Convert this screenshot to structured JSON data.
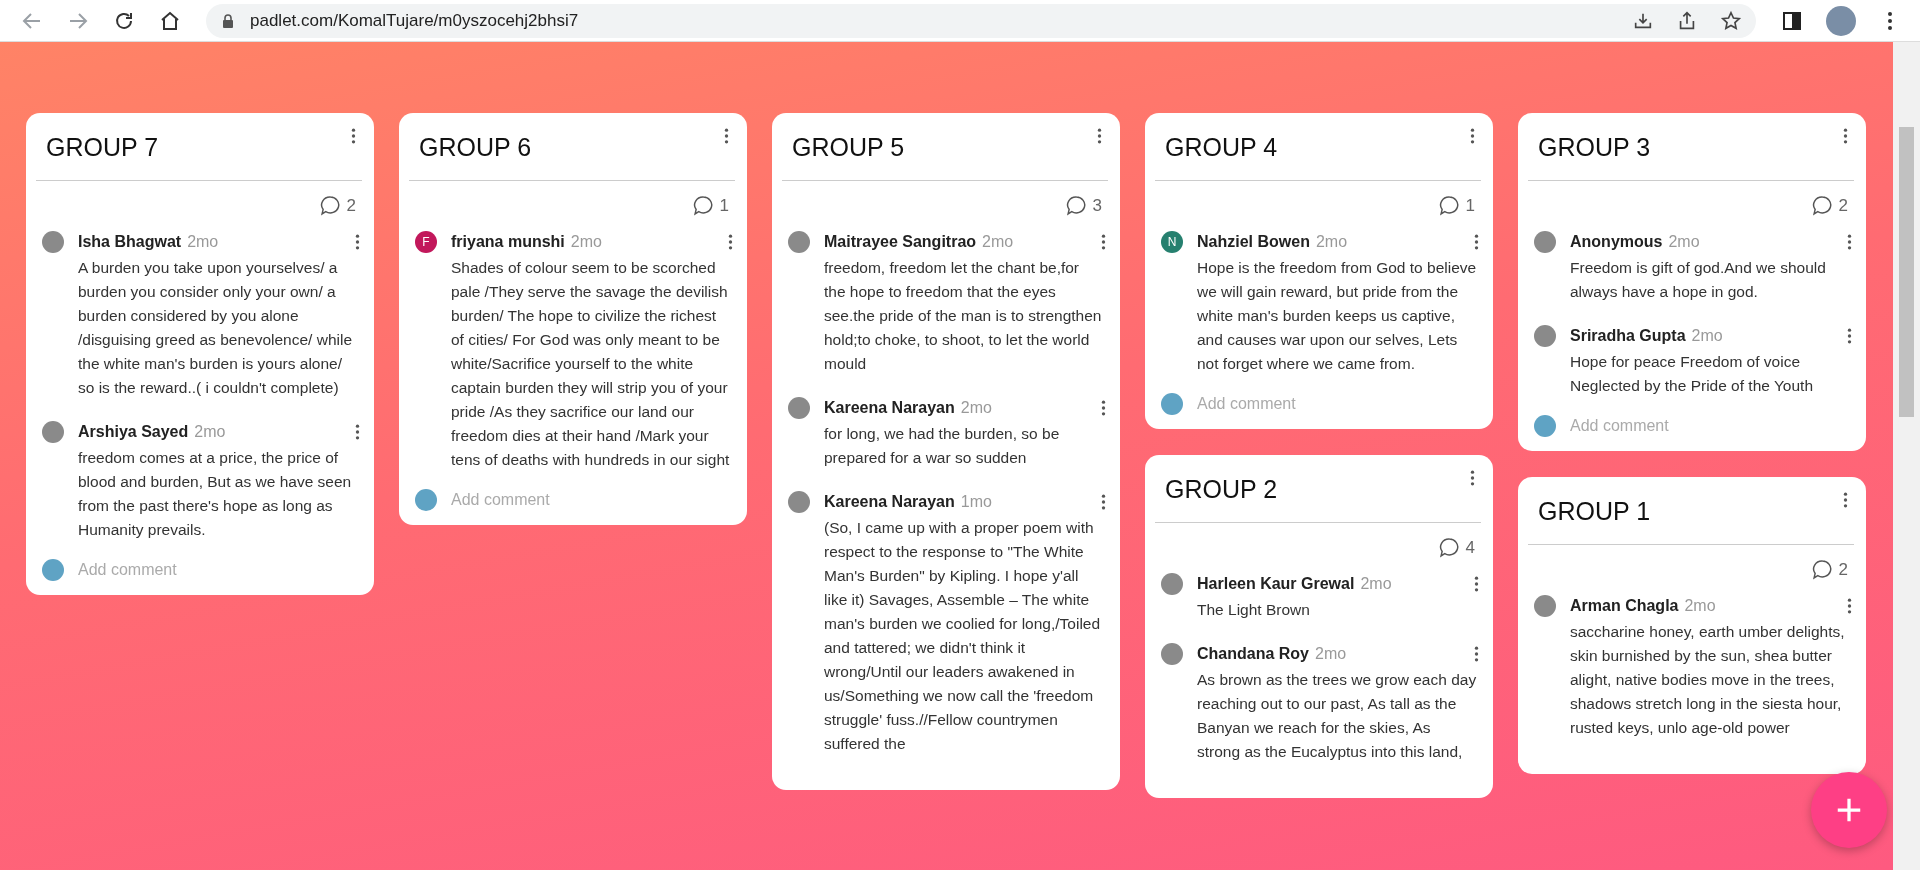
{
  "browser": {
    "url": "padlet.com/KomalTujare/m0yszocehj2bhsi7"
  },
  "columns": [
    {
      "cards": [
        {
          "title": "GROUP 7",
          "comment_count": "2",
          "comments": [
            {
              "author": "Isha Bhagwat",
              "time": "2mo",
              "avatar": {
                "kind": "photo"
              },
              "text": "A burden you take upon yourselves/ a burden you consider only your own/ a burden considered by you alone /disguising greed as benevolence/ while the white man's burden is yours alone/ so is the reward..( i couldn't complete)"
            },
            {
              "author": "Arshiya Sayed",
              "time": "2mo",
              "avatar": {
                "kind": "photo"
              },
              "text": "freedom comes at a price, the price of blood and burden, But as we have seen from the past there's hope as long as Humanity prevails."
            }
          ],
          "add_comment": {
            "placeholder": "Add comment"
          }
        }
      ]
    },
    {
      "cards": [
        {
          "title": "GROUP 6",
          "comment_count": "1",
          "comments": [
            {
              "author": "friyana munshi",
              "time": "2mo",
              "avatar": {
                "kind": "letter",
                "letter": "F",
                "color": "#c2185b"
              },
              "text": "Shades of colour seem to be scorched pale /They serve the savage the devilish burden/ The hope to civilize the richest of cities/ For God was only meant to be white/Sacrifice yourself to the white captain burden they will strip you of your pride /As they sacrifice our land our freedom dies at their hand /Mark your tens of deaths with hundreds in our sight"
            }
          ],
          "add_comment": {
            "placeholder": "Add comment"
          }
        }
      ]
    },
    {
      "cards": [
        {
          "title": "GROUP 5",
          "comment_count": "3",
          "comments": [
            {
              "author": "Maitrayee Sangitrao",
              "time": "2mo",
              "avatar": {
                "kind": "photo"
              },
              "text": "freedom, freedom let the chant be,for the hope to freedom that the eyes see.the pride of the man is to strengthen hold;to choke, to shoot, to let the world mould"
            },
            {
              "author": "Kareena Narayan",
              "time": "2mo",
              "avatar": {
                "kind": "photo"
              },
              "text": "for long, we had the burden, so be prepared for a war so sudden"
            },
            {
              "author": "Kareena Narayan",
              "time": "1mo",
              "avatar": {
                "kind": "photo"
              },
              "text": "(So, I came up with a proper poem with respect to the response to \"The White Man's Burden\" by Kipling. I hope y'all like it) Savages, Assemble – The white man's burden we coolied for long,/Toiled and tattered; we didn't think it wrong/Until our leaders awakened in us/Something we now call the 'freedom struggle' fuss.//Fellow countrymen suffered the"
            }
          ]
        }
      ]
    },
    {
      "cards": [
        {
          "title": "GROUP 4",
          "comment_count": "1",
          "comments": [
            {
              "author": "Nahziel Bowen",
              "time": "2mo",
              "avatar": {
                "kind": "letter",
                "letter": "N",
                "color": "#26806f"
              },
              "text": "Hope is the freedom from God to believe we will gain reward, but pride from the white man's burden keeps us captive, and causes war upon our selves, Lets not forget where we came from."
            }
          ],
          "add_comment": {
            "placeholder": "Add comment"
          }
        },
        {
          "title": "GROUP 2",
          "comment_count": "4",
          "comments": [
            {
              "author": "Harleen Kaur Grewal",
              "time": "2mo",
              "avatar": {
                "kind": "photo"
              },
              "text": "The Light Brown"
            },
            {
              "author": "Chandana Roy",
              "time": "2mo",
              "avatar": {
                "kind": "photo"
              },
              "text": "As brown as the trees we grow each day reaching out to our past, As tall as the Banyan we reach for the skies, As strong as the Eucalyptus into this land,"
            }
          ]
        }
      ]
    },
    {
      "cards": [
        {
          "title": "GROUP 3",
          "comment_count": "2",
          "comments": [
            {
              "author": "Anonymous",
              "time": "2mo",
              "avatar": {
                "kind": "photo"
              },
              "text": "Freedom is gift of god.And we should always have a hope in god."
            },
            {
              "author": "Sriradha Gupta",
              "time": "2mo",
              "avatar": {
                "kind": "photo"
              },
              "text": "Hope for peace Freedom of voice Neglected by the Pride of the Youth"
            }
          ],
          "add_comment": {
            "placeholder": "Add comment"
          }
        },
        {
          "title": "GROUP 1",
          "comment_count": "2",
          "comments": [
            {
              "author": "Arman Chagla",
              "time": "2mo",
              "avatar": {
                "kind": "photo"
              },
              "text": "saccharine honey, earth umber delights, skin burnished by the sun, shea butter alight, native bodies move in the trees, shadows stretch long in the siesta hour, rusted keys, unlo age-old power"
            }
          ]
        }
      ]
    }
  ]
}
